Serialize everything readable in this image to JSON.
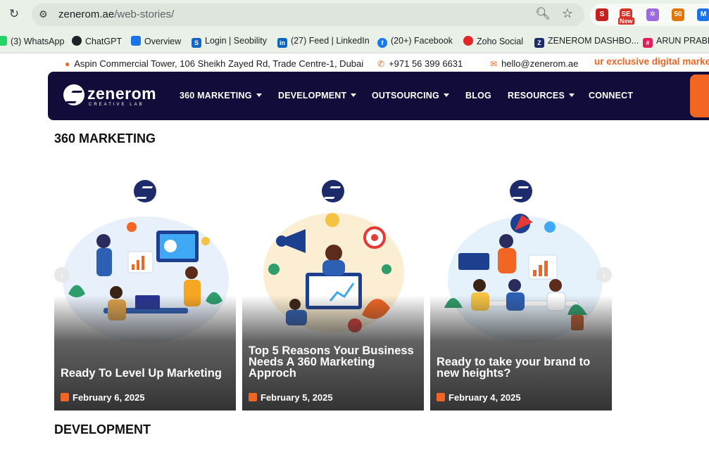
{
  "browser": {
    "url_host": "zenerom.ae",
    "url_path": "/web-stories/",
    "extensions": [
      {
        "label": "S",
        "color": "#c5221f"
      },
      {
        "label": "SE",
        "color": "#d93025"
      },
      {
        "label": "✲",
        "color": "#9c6ade"
      },
      {
        "label": "50",
        "color": "#e37400"
      },
      {
        "label": "M",
        "color": "#1a73e8"
      }
    ],
    "extension_badge": "New",
    "bookmarks": [
      {
        "label": "(3) WhatsApp",
        "icon": "whatsapp-icon",
        "color": "#25d366"
      },
      {
        "label": "ChatGPT",
        "icon": "chatgpt-icon",
        "color": "#202124"
      },
      {
        "label": "Overview",
        "icon": "overview-icon",
        "color": "#1a73e8"
      },
      {
        "label": "Login | Seobility",
        "icon": "seobility-icon",
        "color": "#1565c0"
      },
      {
        "label": "(27) Feed | LinkedIn",
        "icon": "linkedin-icon",
        "color": "#0a66c2"
      },
      {
        "label": "(20+) Facebook",
        "icon": "facebook-icon",
        "color": "#1877f2"
      },
      {
        "label": "Zoho Social",
        "icon": "zoho-icon",
        "color": "#e42527"
      },
      {
        "label": "ZENEROM DASHBO...",
        "icon": "zenerom-icon",
        "color": "#1d2a6b"
      },
      {
        "label": "ARUN PRABHA",
        "icon": "slack-icon",
        "color": "#e01e5a"
      }
    ]
  },
  "topbar": {
    "address": "Aspin Commercial Tower, 106 Sheikh Zayed Rd, Trade Centre-1, Dubai",
    "phone": "+971 56 399 6631",
    "email": "hello@zenerom.ae",
    "promo": "ur exclusive digital marke"
  },
  "nav": {
    "logo_name": "zenerom",
    "logo_tagline": "CREATIVE LAB",
    "items": [
      {
        "label": "360 MARKETING",
        "dropdown": true
      },
      {
        "label": "DEVELOPMENT",
        "dropdown": true
      },
      {
        "label": "OUTSOURCING",
        "dropdown": true
      },
      {
        "label": "BLOG",
        "dropdown": false
      },
      {
        "label": "RESOURCES",
        "dropdown": true
      },
      {
        "label": "CONNECT",
        "dropdown": false
      }
    ]
  },
  "sections": [
    {
      "title": "360 MARKETING"
    },
    {
      "title": "DEVELOPMENT"
    }
  ],
  "stories": [
    {
      "title": "Ready To Level Up Marketing",
      "date": "February 6, 2025"
    },
    {
      "title": "Top 5 Reasons Your Business Needs A 360 Marketing Approch",
      "date": "February 5, 2025"
    },
    {
      "title": "Ready to take your brand to new heights?",
      "date": "February 4, 2025"
    }
  ],
  "carousel": {
    "prev_glyph": "‹",
    "next_glyph": "›"
  },
  "colors": {
    "brand_navy": "#120c3a",
    "accent_orange": "#f26522"
  }
}
